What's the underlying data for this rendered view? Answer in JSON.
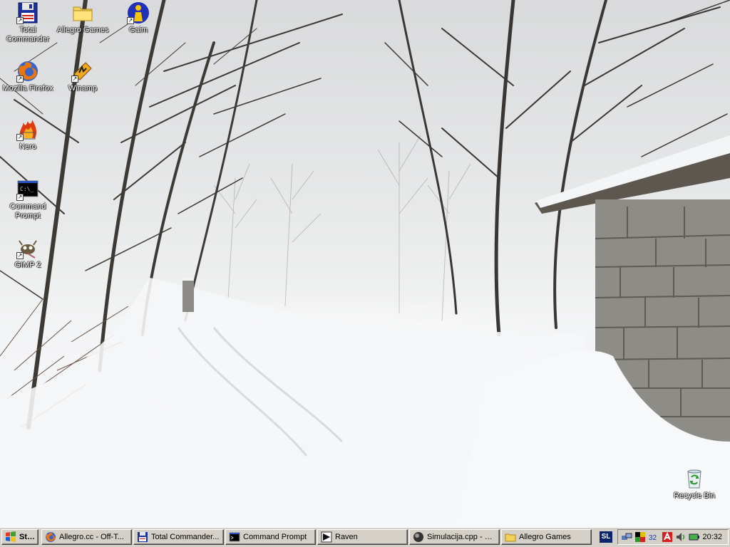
{
  "desktop": {
    "icons": [
      {
        "label": "Total Commander",
        "icon": "floppy-disk-icon",
        "shortcut": true
      },
      {
        "label": "Allegro Games",
        "icon": "folder-icon",
        "shortcut": false
      },
      {
        "label": "Gaim",
        "icon": "gaim-person-icon",
        "shortcut": true
      },
      {
        "label": "Mozilla Firefox",
        "icon": "firefox-icon",
        "shortcut": true
      },
      {
        "label": "Winamp",
        "icon": "winamp-icon",
        "shortcut": true
      },
      {
        "label": "Nero",
        "icon": "nero-flame-icon",
        "shortcut": true
      },
      {
        "label": "Command Prompt",
        "icon": "command-prompt-icon",
        "shortcut": true
      },
      {
        "label": "GIMP 2",
        "icon": "gimp-icon",
        "shortcut": true
      },
      {
        "label": "Recycle Bin",
        "icon": "recycle-bin-icon",
        "shortcut": false
      }
    ],
    "command_prompt_glyph": "C:\\_"
  },
  "taskbar": {
    "start_label": "Start",
    "tasks": [
      {
        "label": "Allegro.cc - Off-T...",
        "icon": "firefox-icon"
      },
      {
        "label": "Total Commander...",
        "icon": "floppy-disk-icon"
      },
      {
        "label": "Command Prompt",
        "icon": "command-prompt-icon"
      },
      {
        "label": "Raven",
        "icon": "raven-icon"
      },
      {
        "label": "Simulacija.cpp - S...",
        "icon": "editor-sphere-icon"
      },
      {
        "label": "Allegro Games",
        "icon": "folder-icon"
      }
    ],
    "language": "SL",
    "tray_icons": [
      "network-icon",
      "color-squares-icon",
      "bit32-icon",
      "antivirus-icon",
      "sound-icon",
      "battery-icon"
    ],
    "tray_text_32": "32",
    "clock": "20:32"
  },
  "colors": {
    "taskbar": "#d4d0c8",
    "language_bg": "#0a246a",
    "wallpaper_sky": "#e4e5e6",
    "snow": "#f7f8f9"
  }
}
